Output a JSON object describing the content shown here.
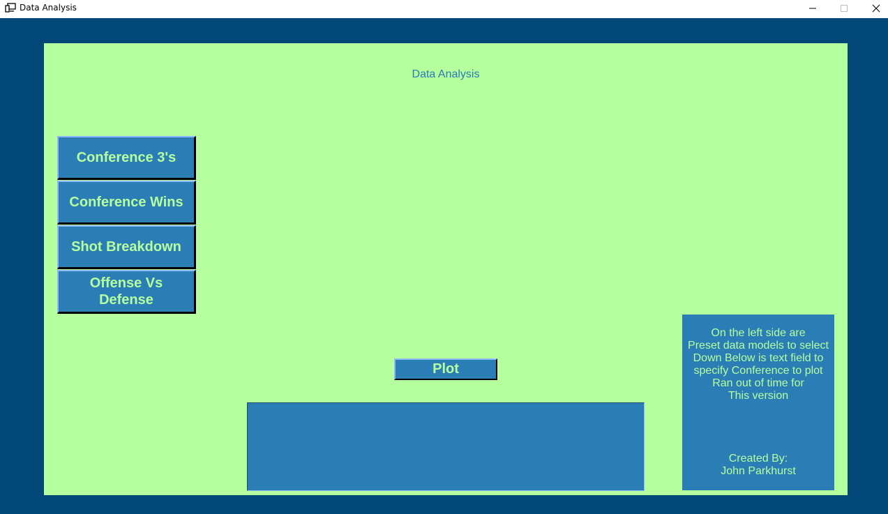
{
  "window": {
    "title": "Data Analysis",
    "icons": [
      "app-icon",
      "minimize-icon",
      "maximize-icon",
      "close-icon"
    ]
  },
  "colors": {
    "frame": "#014879",
    "panel": "#b5ff9e",
    "button": "#2a7db5",
    "button_text": "#b5ff9e",
    "heading": "#2a7ab8"
  },
  "header": {
    "title": "Data Analysis"
  },
  "presets": {
    "conference_3s": "Conference 3's",
    "conference_wins": "Conference Wins",
    "shot_breakdown": "Shot Breakdown",
    "offense_vs_defense_line1": "Offense Vs",
    "offense_vs_defense_line2": "Defense"
  },
  "plot": {
    "label": "Plot"
  },
  "conference_input": {
    "value": ""
  },
  "info": {
    "lines": [
      "On the left side are",
      "Preset data models to select",
      "Down Below is text field to",
      "specify Conference to plot",
      "Ran out of time for",
      "This version"
    ],
    "credit_label": "Created By:",
    "credit_name": "John Parkhurst"
  }
}
